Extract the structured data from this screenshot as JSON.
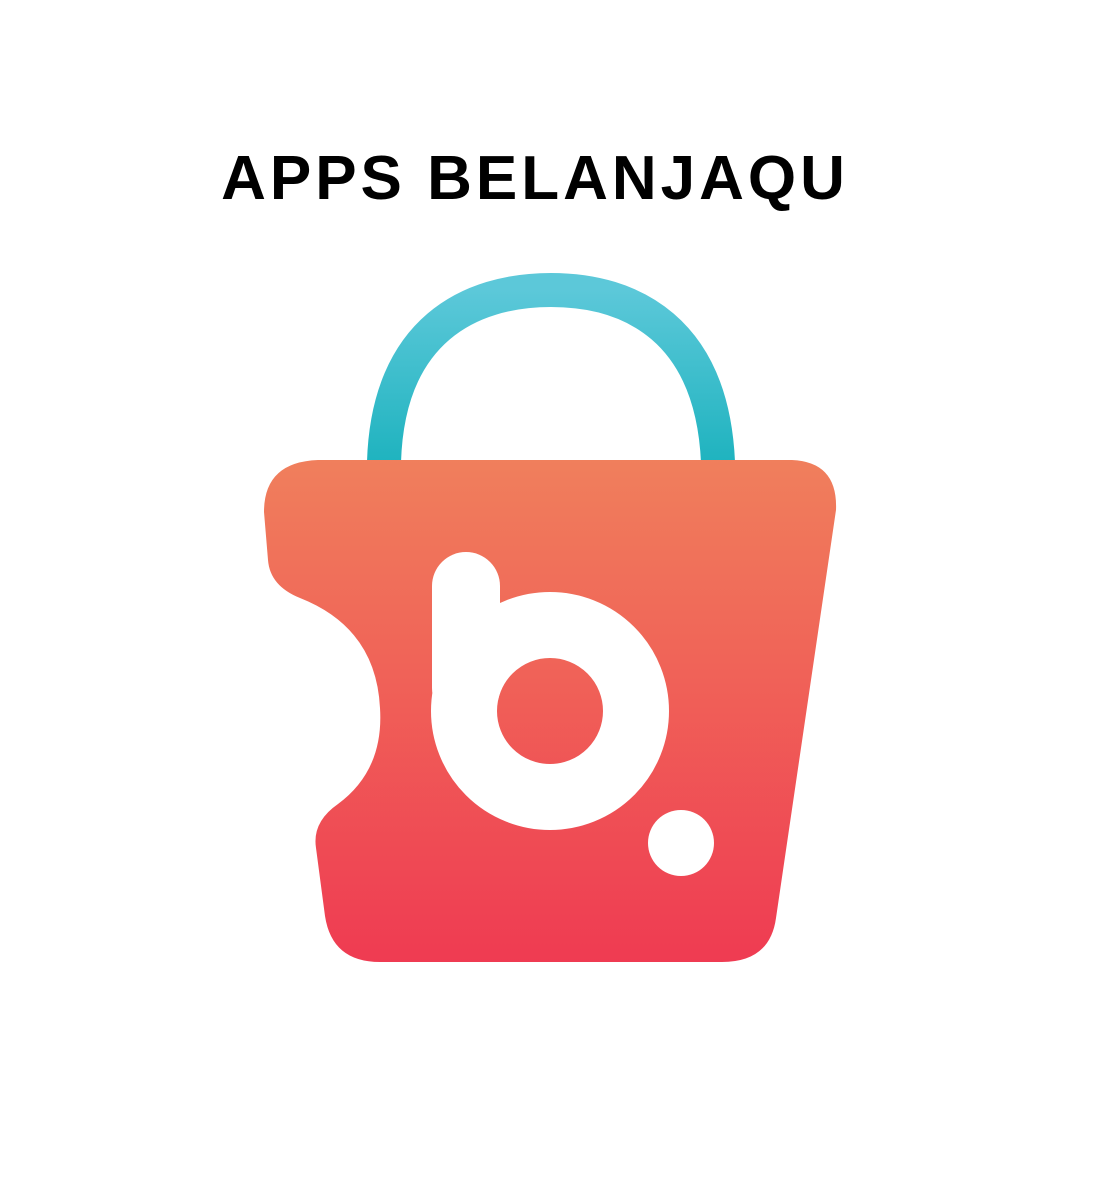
{
  "page": {
    "title": "APPS BELANJAQU"
  },
  "logo": {
    "name": "belanjaqu-bag-logo",
    "handle_color_top": "#5cc8d9",
    "handle_color_bottom": "#1fb3bf",
    "bag_color_top": "#f07f5c",
    "bag_color_bottom": "#ef3b52",
    "letter_color": "#ffffff"
  }
}
